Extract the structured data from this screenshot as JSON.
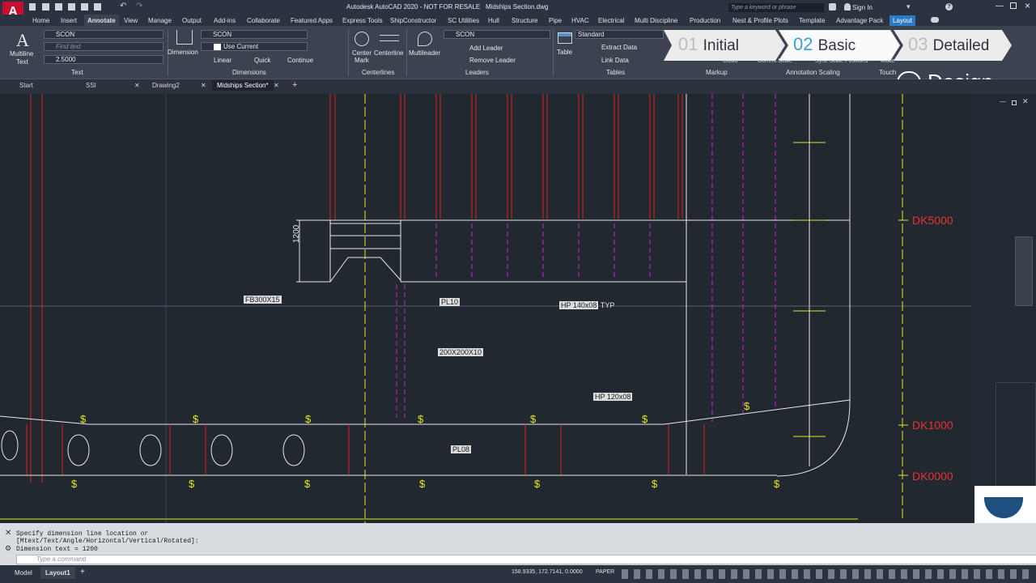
{
  "titlebar": {
    "app_title": "Autodesk AutoCAD 2020 - NOT FOR RESALE",
    "file_name": "Midships Section.dwg",
    "search_placeholder": "Type a keyword or phrase",
    "sign_in": "Sign In",
    "window_buttons": [
      "minimize-icon",
      "maximize-icon",
      "close-icon"
    ]
  },
  "menu": {
    "items": [
      "Home",
      "Insert",
      "Annotate",
      "View",
      "Manage",
      "Output",
      "Add-ins",
      "Collaborate",
      "Featured Apps",
      "Express Tools",
      "ShipConstructor",
      "SC Utilities",
      "Hull",
      "Structure",
      "Pipe",
      "HVAC",
      "Electrical",
      "Multi Discipline",
      "Production",
      "Nest & Profile Plots",
      "Template",
      "Advantage Pack",
      "Layout"
    ],
    "active": "Annotate"
  },
  "ribbon": {
    "text": {
      "multiline": "Multiline",
      "multiline2": "Text",
      "style": "SCON",
      "find_placeholder": "Find text",
      "height": "2.5000",
      "group": "Text"
    },
    "dimensions": {
      "dimension": "Dimension",
      "style": "SCON",
      "use_current": "Use Current",
      "linear": "Linear",
      "quick": "Quick",
      "continue": "Continue",
      "group": "Dimensions"
    },
    "centerlines": {
      "center_mark": "Center",
      "center_mark2": "Mark",
      "centerline": "Centerline",
      "group": "Centerlines"
    },
    "leaders": {
      "multileader": "Multileader",
      "style": "SCON",
      "add_leader": "Add Leader",
      "remove_leader": "Remove Leader",
      "group": "Leaders"
    },
    "tables": {
      "table": "Table",
      "style": "Standard",
      "extract_data": "Extract Data",
      "link_data": "Link Data",
      "group": "Tables"
    },
    "markup": {
      "cloud": "Cloud",
      "group": "Markup"
    },
    "scaling": {
      "current_scale": "Current Scale",
      "sync": "Sync Scale Positions",
      "group": "Annotation Scaling"
    },
    "touch": {
      "mode": "Mode",
      "group": "Touch"
    }
  },
  "steps": [
    {
      "num": "01",
      "label": "Initial"
    },
    {
      "num": "02",
      "label": "Basic"
    },
    {
      "num": "03",
      "label": "Detailed"
    }
  ],
  "design_label": "Design",
  "doctabs": [
    "Start",
    "SSI",
    "Drawing2",
    "Midships Section*"
  ],
  "drawing": {
    "labels": {
      "fb": "FB300X15",
      "pl10": "PL10",
      "hp140": "HP 140x08",
      "typ": "TYP",
      "box200": "200X200X10",
      "hp120": "HP 120x08",
      "pl08": "PL08",
      "dim": "1200"
    },
    "decks": [
      "DK5000",
      "DK1000",
      "DK0000"
    ],
    "colors": {
      "white": "#e8e8e8",
      "red": "#e02020",
      "magenta": "#d020d0",
      "yellow": "#e6e620",
      "deck_red": "#e83030"
    }
  },
  "command": {
    "history": [
      "Specify dimension line location or",
      "[Mtext/Text/Angle/Horizontal/Vertical/Rotated]:",
      "Dimension text = 1200"
    ],
    "placeholder": "Type a command"
  },
  "status": {
    "model_tab": "Model",
    "layout_tab": "Layout1",
    "coords": "158.9335, 172.7141, 0.0000",
    "paper": "PAPER"
  }
}
